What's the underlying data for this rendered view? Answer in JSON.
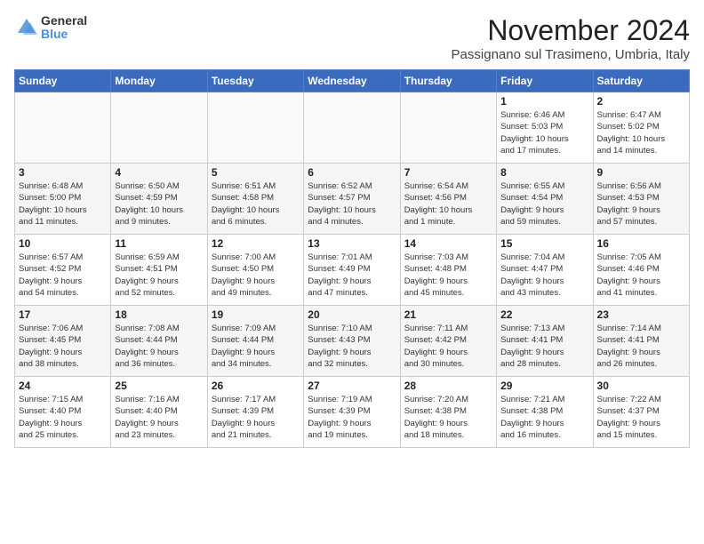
{
  "logo": {
    "general": "General",
    "blue": "Blue"
  },
  "title": {
    "month": "November 2024",
    "location": "Passignano sul Trasimeno, Umbria, Italy"
  },
  "headers": [
    "Sunday",
    "Monday",
    "Tuesday",
    "Wednesday",
    "Thursday",
    "Friday",
    "Saturday"
  ],
  "weeks": [
    [
      {
        "day": "",
        "info": ""
      },
      {
        "day": "",
        "info": ""
      },
      {
        "day": "",
        "info": ""
      },
      {
        "day": "",
        "info": ""
      },
      {
        "day": "",
        "info": ""
      },
      {
        "day": "1",
        "info": "Sunrise: 6:46 AM\nSunset: 5:03 PM\nDaylight: 10 hours\nand 17 minutes."
      },
      {
        "day": "2",
        "info": "Sunrise: 6:47 AM\nSunset: 5:02 PM\nDaylight: 10 hours\nand 14 minutes."
      }
    ],
    [
      {
        "day": "3",
        "info": "Sunrise: 6:48 AM\nSunset: 5:00 PM\nDaylight: 10 hours\nand 11 minutes."
      },
      {
        "day": "4",
        "info": "Sunrise: 6:50 AM\nSunset: 4:59 PM\nDaylight: 10 hours\nand 9 minutes."
      },
      {
        "day": "5",
        "info": "Sunrise: 6:51 AM\nSunset: 4:58 PM\nDaylight: 10 hours\nand 6 minutes."
      },
      {
        "day": "6",
        "info": "Sunrise: 6:52 AM\nSunset: 4:57 PM\nDaylight: 10 hours\nand 4 minutes."
      },
      {
        "day": "7",
        "info": "Sunrise: 6:54 AM\nSunset: 4:56 PM\nDaylight: 10 hours\nand 1 minute."
      },
      {
        "day": "8",
        "info": "Sunrise: 6:55 AM\nSunset: 4:54 PM\nDaylight: 9 hours\nand 59 minutes."
      },
      {
        "day": "9",
        "info": "Sunrise: 6:56 AM\nSunset: 4:53 PM\nDaylight: 9 hours\nand 57 minutes."
      }
    ],
    [
      {
        "day": "10",
        "info": "Sunrise: 6:57 AM\nSunset: 4:52 PM\nDaylight: 9 hours\nand 54 minutes."
      },
      {
        "day": "11",
        "info": "Sunrise: 6:59 AM\nSunset: 4:51 PM\nDaylight: 9 hours\nand 52 minutes."
      },
      {
        "day": "12",
        "info": "Sunrise: 7:00 AM\nSunset: 4:50 PM\nDaylight: 9 hours\nand 49 minutes."
      },
      {
        "day": "13",
        "info": "Sunrise: 7:01 AM\nSunset: 4:49 PM\nDaylight: 9 hours\nand 47 minutes."
      },
      {
        "day": "14",
        "info": "Sunrise: 7:03 AM\nSunset: 4:48 PM\nDaylight: 9 hours\nand 45 minutes."
      },
      {
        "day": "15",
        "info": "Sunrise: 7:04 AM\nSunset: 4:47 PM\nDaylight: 9 hours\nand 43 minutes."
      },
      {
        "day": "16",
        "info": "Sunrise: 7:05 AM\nSunset: 4:46 PM\nDaylight: 9 hours\nand 41 minutes."
      }
    ],
    [
      {
        "day": "17",
        "info": "Sunrise: 7:06 AM\nSunset: 4:45 PM\nDaylight: 9 hours\nand 38 minutes."
      },
      {
        "day": "18",
        "info": "Sunrise: 7:08 AM\nSunset: 4:44 PM\nDaylight: 9 hours\nand 36 minutes."
      },
      {
        "day": "19",
        "info": "Sunrise: 7:09 AM\nSunset: 4:44 PM\nDaylight: 9 hours\nand 34 minutes."
      },
      {
        "day": "20",
        "info": "Sunrise: 7:10 AM\nSunset: 4:43 PM\nDaylight: 9 hours\nand 32 minutes."
      },
      {
        "day": "21",
        "info": "Sunrise: 7:11 AM\nSunset: 4:42 PM\nDaylight: 9 hours\nand 30 minutes."
      },
      {
        "day": "22",
        "info": "Sunrise: 7:13 AM\nSunset: 4:41 PM\nDaylight: 9 hours\nand 28 minutes."
      },
      {
        "day": "23",
        "info": "Sunrise: 7:14 AM\nSunset: 4:41 PM\nDaylight: 9 hours\nand 26 minutes."
      }
    ],
    [
      {
        "day": "24",
        "info": "Sunrise: 7:15 AM\nSunset: 4:40 PM\nDaylight: 9 hours\nand 25 minutes."
      },
      {
        "day": "25",
        "info": "Sunrise: 7:16 AM\nSunset: 4:40 PM\nDaylight: 9 hours\nand 23 minutes."
      },
      {
        "day": "26",
        "info": "Sunrise: 7:17 AM\nSunset: 4:39 PM\nDaylight: 9 hours\nand 21 minutes."
      },
      {
        "day": "27",
        "info": "Sunrise: 7:19 AM\nSunset: 4:39 PM\nDaylight: 9 hours\nand 19 minutes."
      },
      {
        "day": "28",
        "info": "Sunrise: 7:20 AM\nSunset: 4:38 PM\nDaylight: 9 hours\nand 18 minutes."
      },
      {
        "day": "29",
        "info": "Sunrise: 7:21 AM\nSunset: 4:38 PM\nDaylight: 9 hours\nand 16 minutes."
      },
      {
        "day": "30",
        "info": "Sunrise: 7:22 AM\nSunset: 4:37 PM\nDaylight: 9 hours\nand 15 minutes."
      }
    ]
  ]
}
